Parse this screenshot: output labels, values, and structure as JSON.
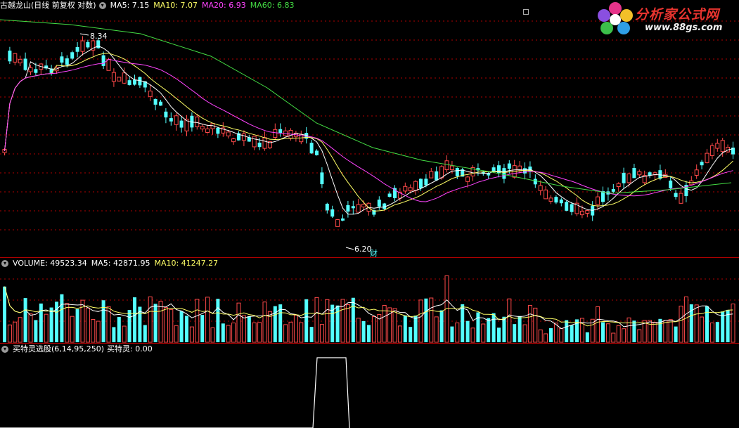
{
  "price_panel": {
    "title": "古越龙山(日线 前复权 对数)",
    "ma5_label": "MA5: 7.15",
    "ma10_label": "MA10: 7.07",
    "ma20_label": "MA20: 6.93",
    "ma60_label": "MA60: 6.83",
    "high_marker": "8.34",
    "low_marker": "6.20",
    "cai_marker": "财"
  },
  "volume_panel": {
    "title": "VOLUME: 49523.34",
    "ma5_label": "MA5: 42871.95",
    "ma10_label": "MA10: 41247.27"
  },
  "indicator_panel": {
    "title": "买特灵选股(6,14,95,250)",
    "value_label": "买特灵: 0.00"
  },
  "watermark": {
    "brand": "分析家公式网",
    "url": "www.88gs.com"
  },
  "colors": {
    "up": "#ff4a4a",
    "down": "#54ffff",
    "ma5": "#ffffff",
    "ma10": "#ffff66",
    "ma20": "#ff44ff",
    "ma60": "#44dd44",
    "grid": "#b00000"
  }
}
